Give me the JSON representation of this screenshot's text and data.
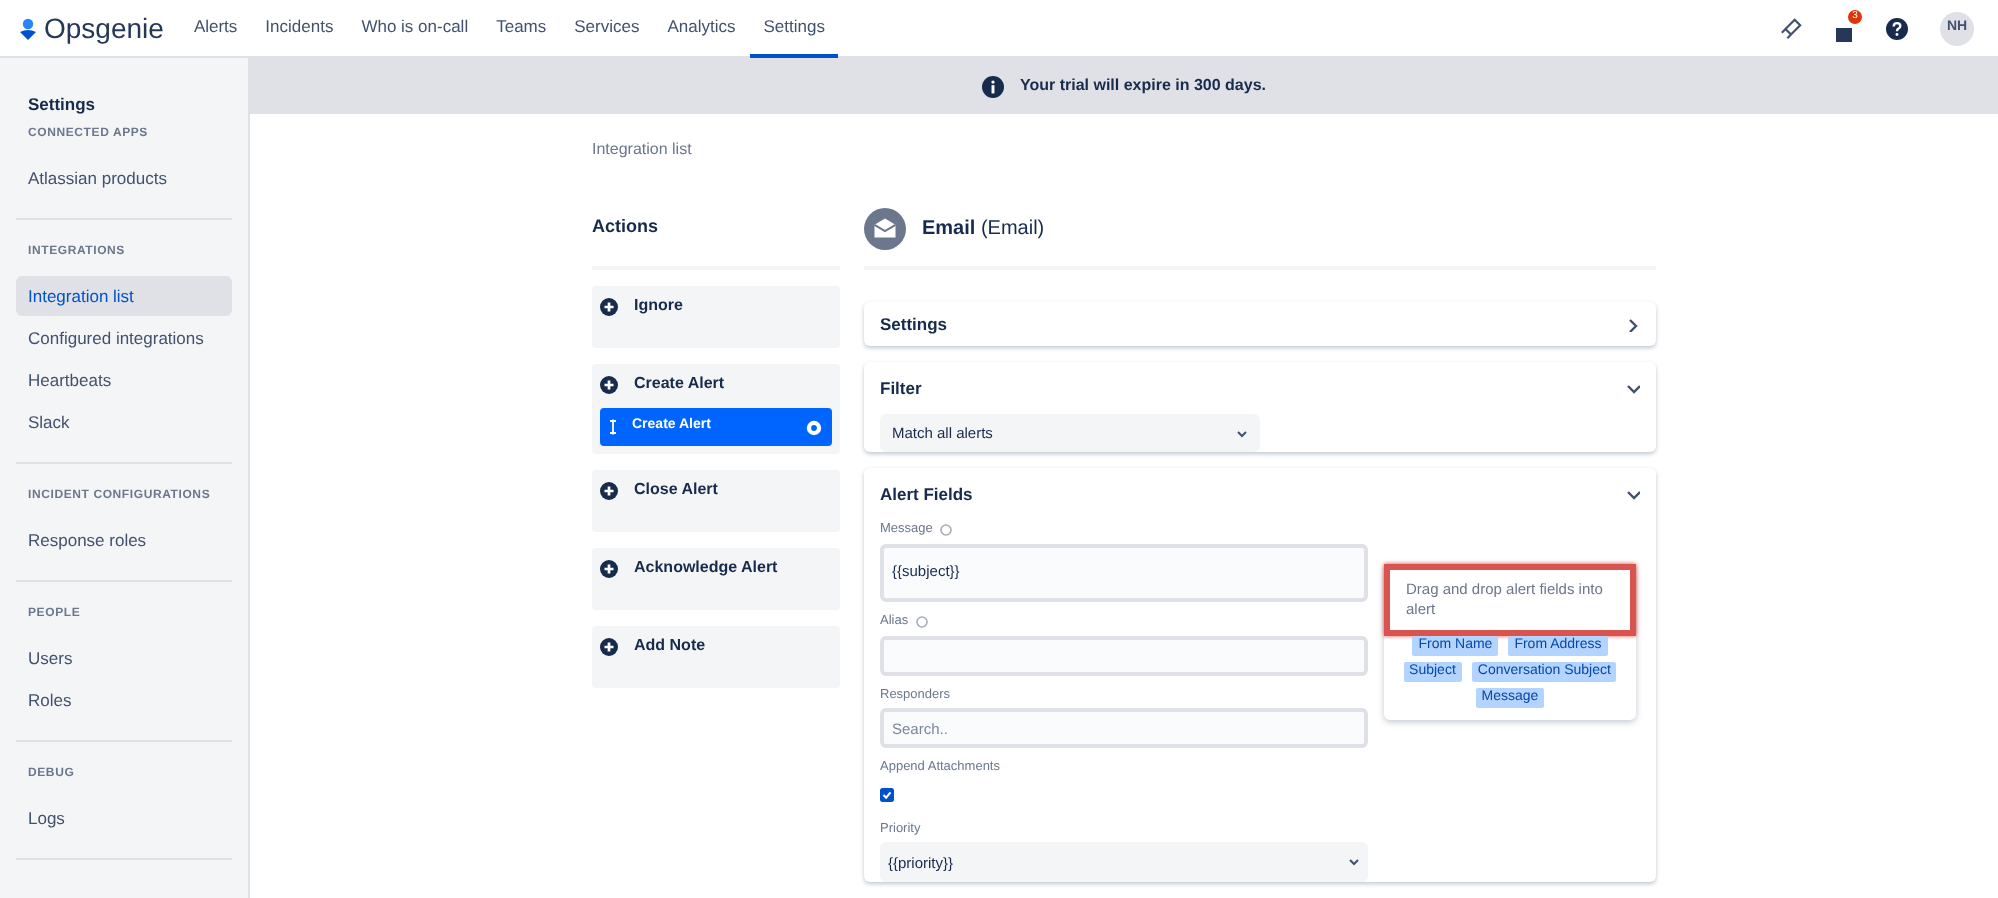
{
  "brand": "Opsgenie",
  "nav": [
    {
      "label": "Alerts",
      "selected": false
    },
    {
      "label": "Incidents",
      "selected": false
    },
    {
      "label": "Who is on-call",
      "selected": false
    },
    {
      "label": "Teams",
      "selected": false
    },
    {
      "label": "Services",
      "selected": false
    },
    {
      "label": "Analytics",
      "selected": false
    },
    {
      "label": "Settings",
      "selected": true
    }
  ],
  "header": {
    "notification_count": "3",
    "avatar": "NH"
  },
  "sidebar": {
    "title": "Settings",
    "sections": [
      {
        "heading": "CONNECTED APPS",
        "items": [
          {
            "label": "Atlassian products",
            "selected": false
          }
        ]
      },
      {
        "heading": "INTEGRATIONS",
        "items": [
          {
            "label": "Integration list",
            "selected": true
          },
          {
            "label": "Configured integrations",
            "selected": false
          },
          {
            "label": "Heartbeats",
            "selected": false
          },
          {
            "label": "Slack",
            "selected": false
          }
        ]
      },
      {
        "heading": "INCIDENT CONFIGURATIONS",
        "items": [
          {
            "label": "Response roles",
            "selected": false
          }
        ]
      },
      {
        "heading": "PEOPLE",
        "items": [
          {
            "label": "Users",
            "selected": false
          },
          {
            "label": "Roles",
            "selected": false
          }
        ]
      },
      {
        "heading": "DEBUG",
        "items": [
          {
            "label": "Logs",
            "selected": false
          }
        ]
      }
    ]
  },
  "banner": "Your trial will expire in 300 days.",
  "breadcrumb": "Integration list",
  "actions": {
    "title": "Actions",
    "items": [
      {
        "label": "Ignore"
      },
      {
        "label": "Create Alert",
        "rules": [
          {
            "label": "Create Alert",
            "selected": true
          }
        ]
      },
      {
        "label": "Close Alert"
      },
      {
        "label": "Acknowledge Alert"
      },
      {
        "label": "Add Note"
      }
    ]
  },
  "integration": {
    "title": "**Email** (Email)"
  },
  "panels": [
    {
      "kind": "link",
      "title": "Settings",
      "expanded": false
    },
    {
      "kind": "filter",
      "title": "Filter",
      "expanded": true,
      "value": "Match all alerts"
    },
    {
      "kind": "fields",
      "title": "Alert Fields",
      "expanded": true,
      "fields": [
        {
          "kind": "textarea",
          "label": "Message",
          "help": true,
          "value": "{{subject}}"
        },
        {
          "kind": "text",
          "label": "Alias",
          "help": true
        },
        {
          "kind": "search",
          "label": "Responders",
          "help": false,
          "placeholder": "Search.."
        },
        {
          "kind": "checkbox",
          "label": "Append Attachments",
          "help": false,
          "checked": true
        },
        {
          "kind": "select",
          "label": "Priority",
          "help": false,
          "value": "{{priority}}"
        }
      ],
      "drag": {
        "hint": "Drag and drop alert fields into alert",
        "highlighted": true,
        "chips": [
          "From Name",
          "From Address",
          "Subject",
          "Conversation Subject",
          "Message"
        ]
      }
    }
  ]
}
